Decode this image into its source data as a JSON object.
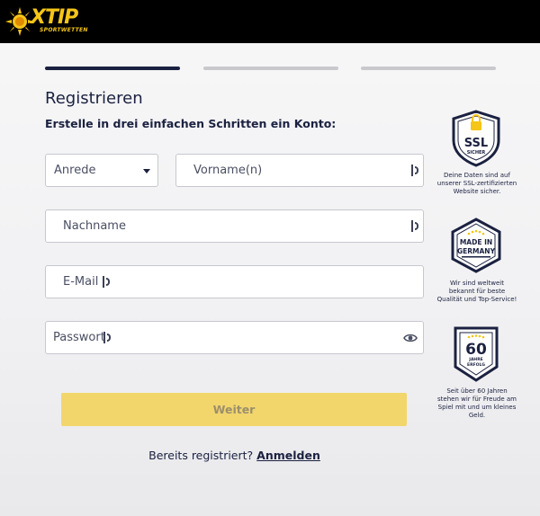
{
  "header": {
    "brand": "XTIP",
    "brand_sub": "SPORTWETTEN"
  },
  "progress": {
    "current_step": 1,
    "total_steps": 3
  },
  "form": {
    "title": "Registrieren",
    "subtitle": "Erstelle in drei einfachen Schritten ein Konto:",
    "anrede_placeholder": "Anrede",
    "vorname_placeholder": "Vorname(n)",
    "nachname_placeholder": "Nachname",
    "email_placeholder": "E-Mail",
    "passwort_placeholder": "Passwort",
    "submit_label": "Weiter",
    "already_registered": "Bereits registriert?",
    "login_link": "Anmelden"
  },
  "badges": [
    {
      "icon": "ssl-shield-icon",
      "text": "SSL",
      "sub": "SICHER",
      "caption": "Deine Daten sind auf unserer SSL-zertifizierten Website sicher."
    },
    {
      "icon": "made-in-germany-icon",
      "text": "MADE IN GERMANY",
      "caption": "Wir sind weltweit bekannt für beste Qualität und Top-Service!"
    },
    {
      "icon": "sixty-years-icon",
      "text": "60",
      "sub": "JAHRE ERFOLG",
      "caption": "Seit über 60 Jahren stehen wir für Freude am Spiel mit und um kleines Geld."
    }
  ],
  "colors": {
    "primary": "#1b2140",
    "accent": "#f5c518",
    "button_disabled": "#f2d66c"
  }
}
